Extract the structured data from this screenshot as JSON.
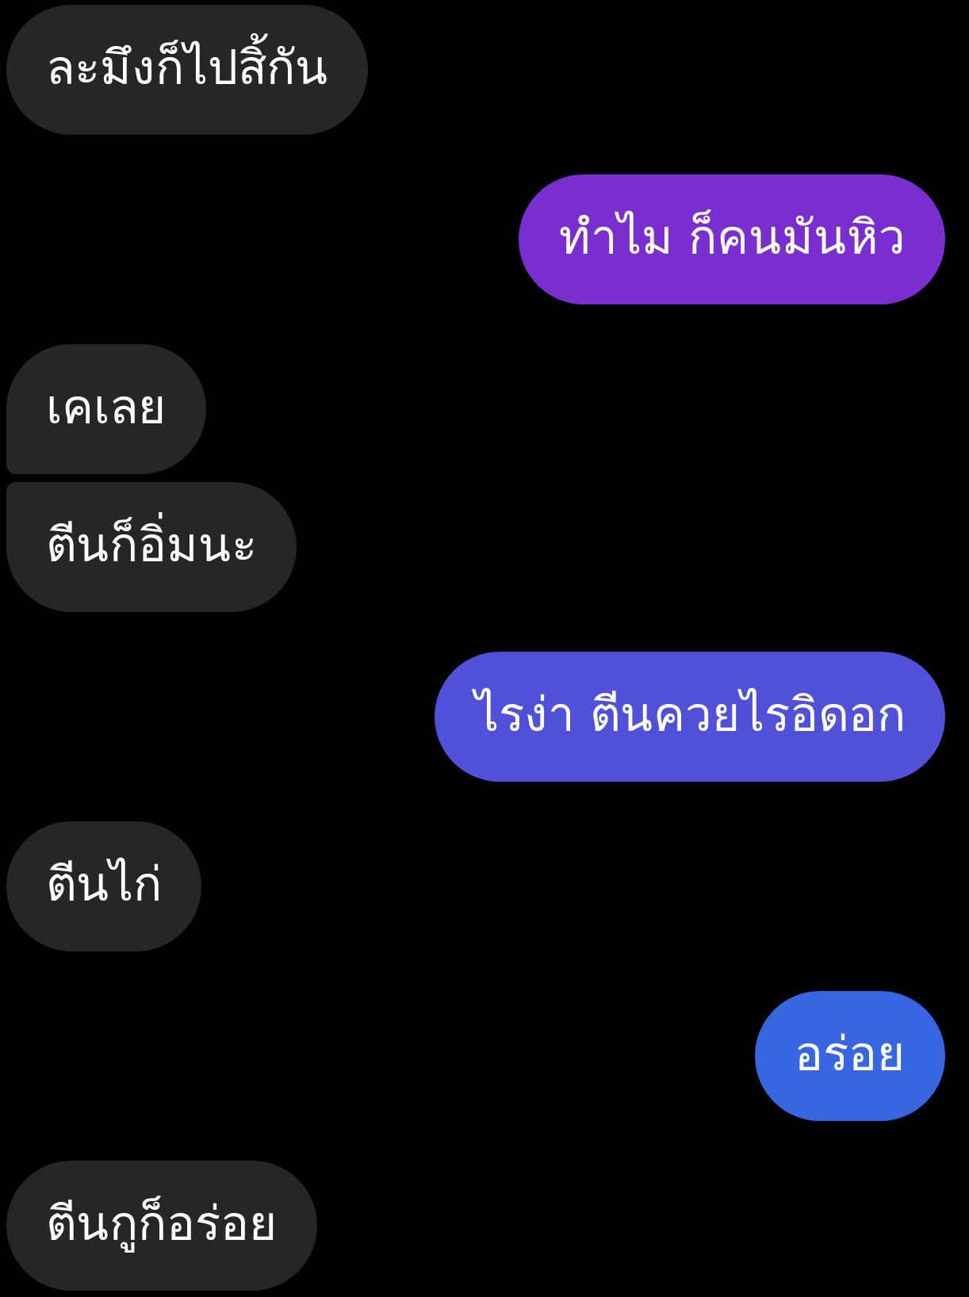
{
  "messages": [
    {
      "kind": "received",
      "joined_above": false,
      "joined_below": false,
      "text": "ละมึงก็ไปสิ้กัน"
    },
    {
      "kind": "sent",
      "joined_above": false,
      "joined_below": false,
      "color": "#7a2ecf",
      "text": "ทำไม ก็คนมันหิว"
    },
    {
      "kind": "received",
      "joined_above": false,
      "joined_below": true,
      "text": "เคเลย"
    },
    {
      "kind": "received",
      "joined_above": true,
      "joined_below": false,
      "text": "ตีนก็อิ่มนะ"
    },
    {
      "kind": "sent",
      "joined_above": false,
      "joined_below": false,
      "color": "#5050d9",
      "text": "ไรง่า ตีนควยไรอิดอก"
    },
    {
      "kind": "received",
      "joined_above": false,
      "joined_below": false,
      "text": "ตีนไก่"
    },
    {
      "kind": "sent",
      "joined_above": false,
      "joined_below": false,
      "color": "#3766e0",
      "text": "อร่อย"
    },
    {
      "kind": "received",
      "joined_above": false,
      "joined_below": false,
      "text": "ตีนกูก็อร่อย"
    }
  ]
}
